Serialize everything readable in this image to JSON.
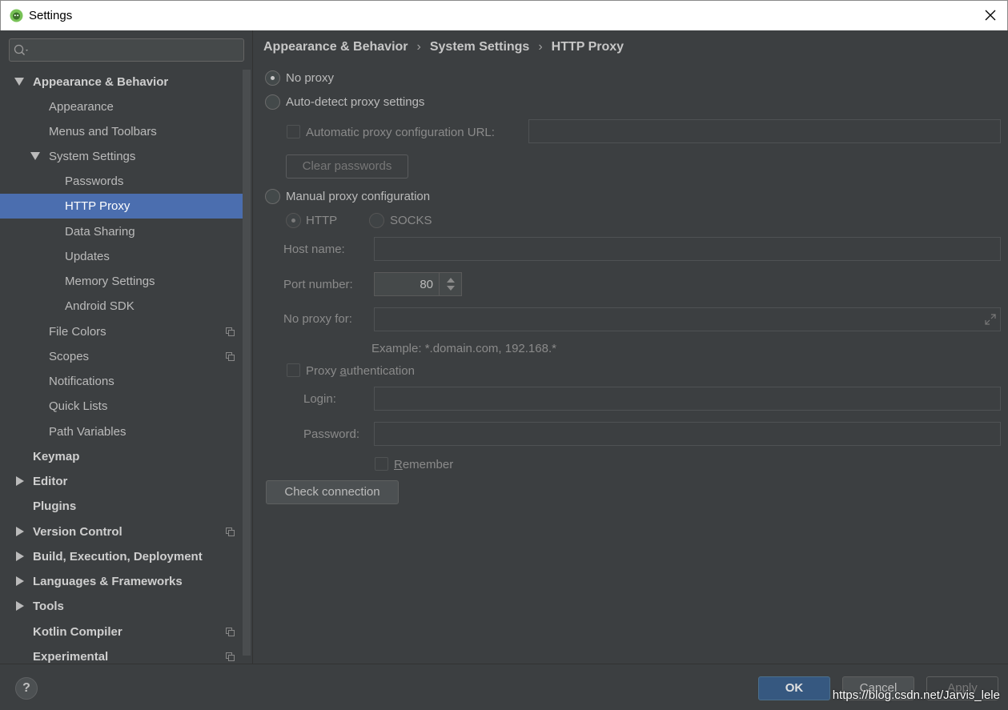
{
  "window": {
    "title": "Settings"
  },
  "search": {
    "placeholder": ""
  },
  "tree": {
    "appearance_behavior": "Appearance & Behavior",
    "appearance": "Appearance",
    "menus_toolbars": "Menus and Toolbars",
    "system_settings": "System Settings",
    "passwords": "Passwords",
    "http_proxy": "HTTP Proxy",
    "data_sharing": "Data Sharing",
    "updates": "Updates",
    "memory_settings": "Memory Settings",
    "android_sdk": "Android SDK",
    "file_colors": "File Colors",
    "scopes": "Scopes",
    "notifications": "Notifications",
    "quick_lists": "Quick Lists",
    "path_variables": "Path Variables",
    "keymap": "Keymap",
    "editor": "Editor",
    "plugins": "Plugins",
    "version_control": "Version Control",
    "build": "Build, Execution, Deployment",
    "languages": "Languages & Frameworks",
    "tools": "Tools",
    "kotlin": "Kotlin Compiler",
    "experimental": "Experimental"
  },
  "breadcrumb": {
    "item1": "Appearance & Behavior",
    "item2": "System Settings",
    "item3": "HTTP Proxy",
    "separator": "›"
  },
  "proxy": {
    "no_proxy": "No proxy",
    "auto_detect": "Auto-detect proxy settings",
    "auto_url_label": "Automatic proxy configuration URL:",
    "auto_url_value": "",
    "clear_passwords": "Clear passwords",
    "manual": "Manual proxy configuration",
    "http": "HTTP",
    "socks": "SOCKS",
    "host_label": "Host name:",
    "host_value": "",
    "port_label": "Port number:",
    "port_value": "80",
    "no_proxy_for_label": "No proxy for:",
    "no_proxy_for_value": "",
    "example": "Example: *.domain.com, 192.168.*",
    "auth_label_pre": "Proxy ",
    "auth_label_u": "a",
    "auth_label_post": "uthentication",
    "login_label": "Login:",
    "login_value": "",
    "password_label": "Password:",
    "password_value": "",
    "remember_u": "R",
    "remember_rest": "emember",
    "check_connection": "Check connection"
  },
  "footer": {
    "help": "?",
    "ok": "OK",
    "cancel": "Cancel",
    "apply": "Apply",
    "watermark": "https://blog.csdn.net/Jarvis_lele"
  },
  "colors": {
    "selection": "#4b6eaf",
    "ok_button": "#365880",
    "background": "#3c3f41"
  }
}
